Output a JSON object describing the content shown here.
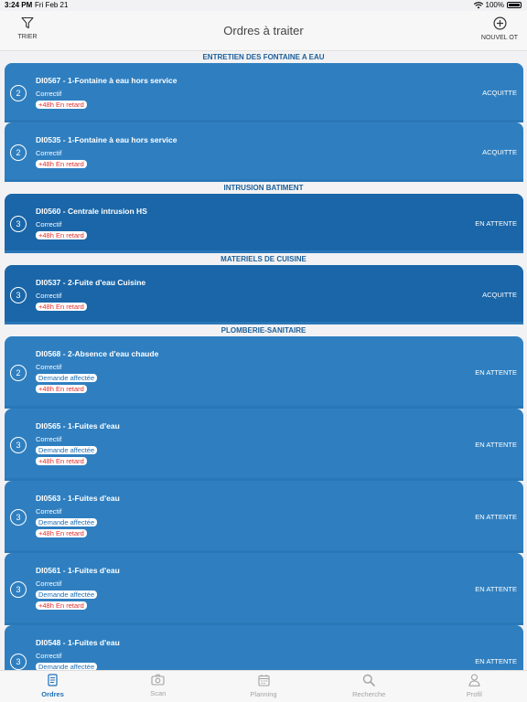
{
  "status_bar": {
    "time": "3:24 PM",
    "date": "Fri Feb 21",
    "battery": "100%"
  },
  "navbar": {
    "title": "Ordres à traiter",
    "left_button": "TRIER",
    "right_button": "NOUVEL OT",
    "left_icon": "filter-icon",
    "right_icon": "plus-circle-icon"
  },
  "colors": {
    "card_light": "#2f7fc0",
    "card_dark": "#1a66a8",
    "section_header_text": "#1c5f99",
    "late_text": "#e0302c",
    "active_tab": "#1f6fb4"
  },
  "sections": [
    {
      "title": "ENTRETIEN DES FONTAINE A EAU",
      "items": [
        {
          "priority": "2",
          "title": "DI0567 - 1-Fontaine à eau hors service",
          "type": "Correctif",
          "tags": [
            "+48h En retard"
          ],
          "status": "ACQUITTE"
        },
        {
          "priority": "2",
          "title": "DI0535 - 1-Fontaine à eau hors service",
          "type": "Correctif",
          "tags": [
            "+48h En retard"
          ],
          "status": "ACQUITTE"
        }
      ]
    },
    {
      "title": "INTRUSION BATIMENT",
      "items": [
        {
          "priority": "3",
          "title": "DI0560 - Centrale intrusion HS",
          "type": "Correctif",
          "tags": [
            "+48h En retard"
          ],
          "status": "EN ATTENTE"
        }
      ]
    },
    {
      "title": "MATERIELS DE CUISINE",
      "items": [
        {
          "priority": "3",
          "title": "DI0537 - 2-Fuite d'eau Cuisine",
          "type": "Correctif",
          "tags": [
            "+48h En retard"
          ],
          "status": "ACQUITTE"
        }
      ]
    },
    {
      "title": "PLOMBERIE-SANITAIRE",
      "items": [
        {
          "priority": "2",
          "title": "DI0568 - 2-Absence d'eau chaude",
          "type": "Correctif",
          "tags": [
            "Demande affectée",
            "+48h En retard"
          ],
          "status": "EN ATTENTE"
        },
        {
          "priority": "3",
          "title": "DI0565 - 1-Fuites d'eau",
          "type": "Correctif",
          "tags": [
            "Demande affectée",
            "+48h En retard"
          ],
          "status": "EN ATTENTE"
        },
        {
          "priority": "3",
          "title": "DI0563 - 1-Fuites d'eau",
          "type": "Correctif",
          "tags": [
            "Demande affectée",
            "+48h En retard"
          ],
          "status": "EN ATTENTE"
        },
        {
          "priority": "3",
          "title": "DI0561 - 1-Fuites d'eau",
          "type": "Correctif",
          "tags": [
            "Demande affectée",
            "+48h En retard"
          ],
          "status": "EN ATTENTE"
        },
        {
          "priority": "3",
          "title": "DI0548 - 1-Fuites d'eau",
          "type": "Correctif",
          "tags": [
            "Demande affectée"
          ],
          "status": "EN ATTENTE"
        }
      ]
    }
  ],
  "tabs": [
    {
      "label": "Ordres",
      "icon": "document-icon",
      "active": true
    },
    {
      "label": "Scan",
      "icon": "camera-icon",
      "active": false
    },
    {
      "label": "Planning",
      "icon": "calendar-icon",
      "active": false
    },
    {
      "label": "Recherche",
      "icon": "search-icon",
      "active": false
    },
    {
      "label": "Profil",
      "icon": "person-icon",
      "active": false
    }
  ]
}
